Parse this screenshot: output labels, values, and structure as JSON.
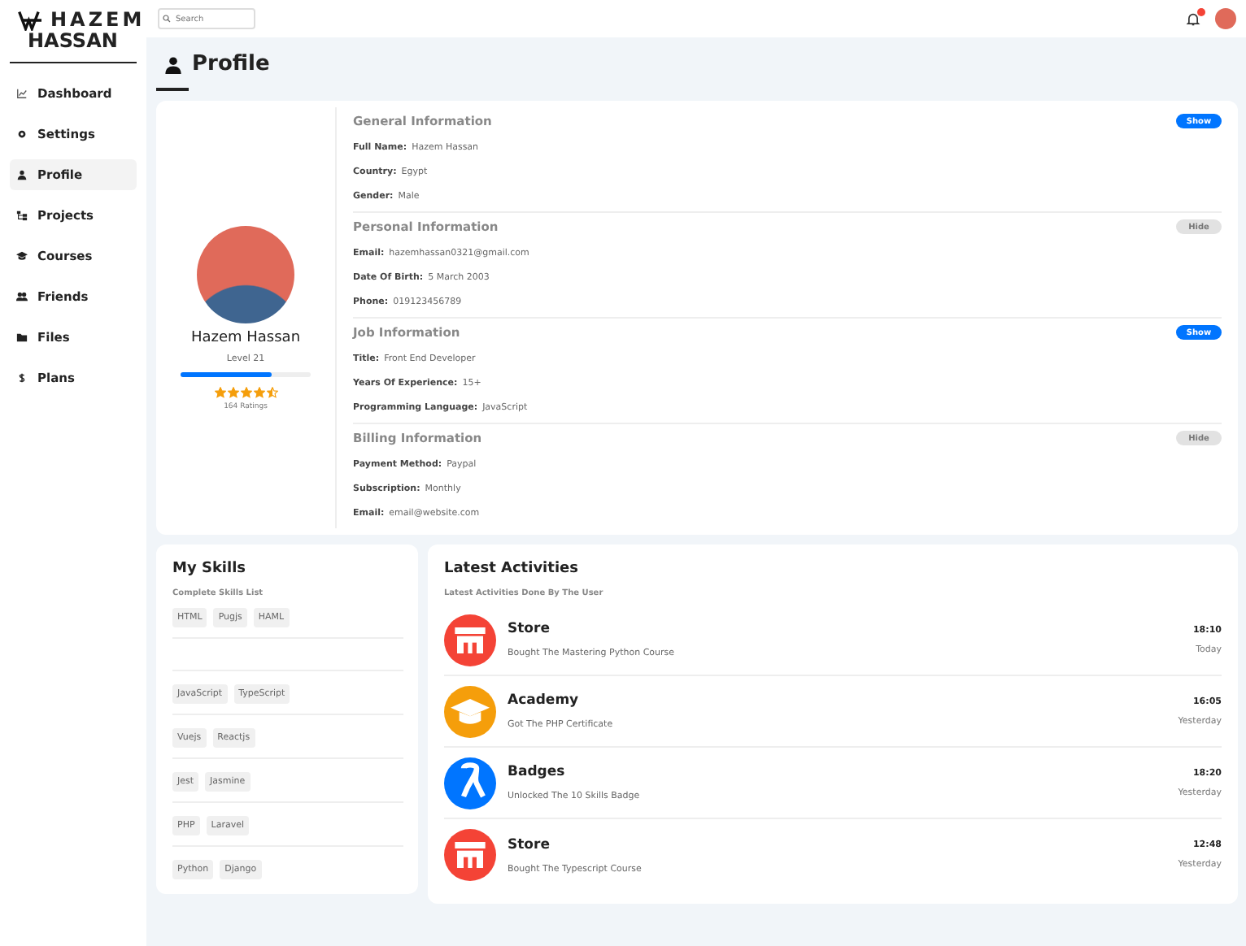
{
  "logo": {
    "line1": "HAZEM",
    "line2": "HASSAN"
  },
  "search": {
    "placeholder": "Search"
  },
  "notifications": {
    "unread": true
  },
  "sidebar": {
    "items": [
      {
        "label": "Dashboard",
        "selected": false
      },
      {
        "label": "Settings",
        "selected": false
      },
      {
        "label": "Profile",
        "selected": true
      },
      {
        "label": "Projects",
        "selected": false
      },
      {
        "label": "Courses",
        "selected": false
      },
      {
        "label": "Friends",
        "selected": false
      },
      {
        "label": "Files",
        "selected": false
      },
      {
        "label": "Plans",
        "selected": false
      }
    ]
  },
  "page_title": "Profile",
  "profile": {
    "name": "Hazem Hassan",
    "level_text": "Level 21",
    "level": 0.7,
    "stars": 4.5,
    "ratings": "164 Ratings"
  },
  "sections": [
    {
      "title": "General Information",
      "toggle": {
        "label": "Show",
        "on": true
      },
      "fields": [
        {
          "label": "Full Name:",
          "value": "Hazem Hassan"
        },
        {
          "label": "Country:",
          "value": "Egypt"
        },
        {
          "label": "Gender:",
          "value": "Male"
        }
      ]
    },
    {
      "title": "Personal Information",
      "toggle": {
        "label": "Hide",
        "on": false
      },
      "fields": [
        {
          "label": "Email:",
          "value": "hazemhassan0321@gmail.com"
        },
        {
          "label": "Date Of Birth:",
          "value": "5 March 2003"
        },
        {
          "label": "Phone:",
          "value": "019123456789"
        }
      ]
    },
    {
      "title": "Job Information",
      "toggle": {
        "label": "Show",
        "on": true
      },
      "fields": [
        {
          "label": "Title:",
          "value": "Front End Developer"
        },
        {
          "label": "Years Of Experience:",
          "value": "15+"
        },
        {
          "label": "Programming Language:",
          "value": "JavaScript"
        }
      ]
    },
    {
      "title": "Billing Information",
      "toggle": {
        "label": "Hide",
        "on": false
      },
      "fields": [
        {
          "label": "Payment Method:",
          "value": "Paypal"
        },
        {
          "label": "Subscription:",
          "value": "Monthly"
        },
        {
          "label": "Email:",
          "value": "email@website.com"
        }
      ]
    }
  ],
  "skills": {
    "title": "My Skills",
    "subtitle": "Complete Skills List",
    "rows": [
      [
        "HTML",
        "Pugjs",
        "HAML"
      ],
      [],
      [
        "JavaScript",
        "TypeScript"
      ],
      [
        "Vuejs",
        "Reactjs"
      ],
      [
        "Jest",
        "Jasmine"
      ],
      [
        "PHP",
        "Laravel"
      ],
      [
        "Python",
        "Django"
      ]
    ]
  },
  "activities": {
    "title": "Latest Activities",
    "subtitle": "Latest Activities Done By The User",
    "items": [
      {
        "kind": "store",
        "title": "Store",
        "description": "Bought The Mastering Python Course",
        "time": "18:10",
        "day": "Today"
      },
      {
        "kind": "academy",
        "title": "Academy",
        "description": "Got The PHP Certificate",
        "time": "16:05",
        "day": "Yesterday"
      },
      {
        "kind": "badges",
        "title": "Badges",
        "description": "Unlocked The 10 Skills Badge",
        "time": "18:20",
        "day": "Yesterday"
      },
      {
        "kind": "store",
        "title": "Store",
        "description": "Bought The Typescript Course",
        "time": "12:48",
        "day": "Yesterday"
      }
    ]
  }
}
